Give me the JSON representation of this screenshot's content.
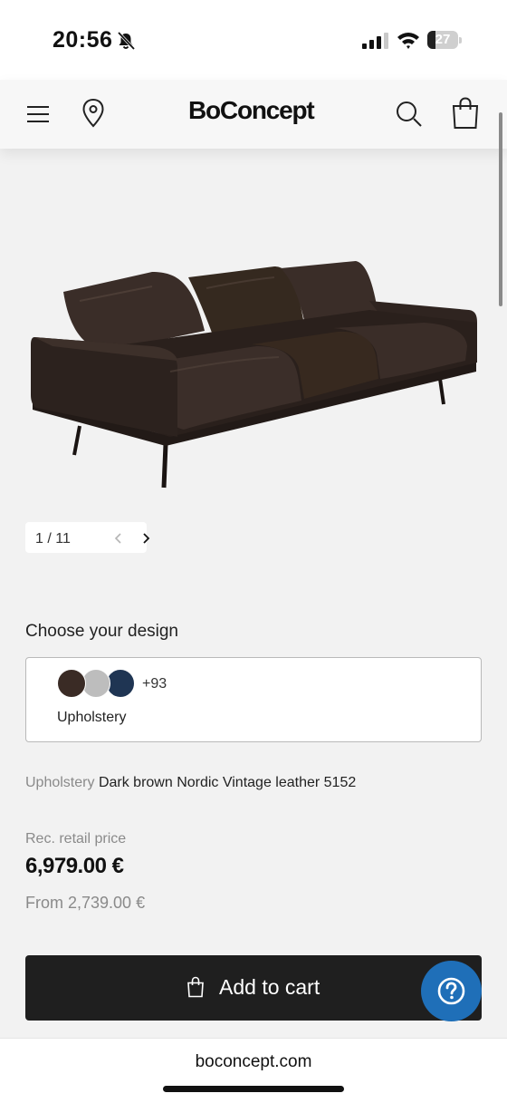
{
  "status_bar": {
    "time": "20:56",
    "battery": "27",
    "battery_level": 0.27
  },
  "header": {
    "logo": "BoConcept",
    "menu_icon": "hamburger-menu-icon",
    "location_icon": "location-pin-icon",
    "search_icon": "search-icon",
    "cart_icon": "shopping-bag-icon"
  },
  "gallery": {
    "pager": "1 / 11",
    "current_image": 1,
    "total_images": 11
  },
  "design": {
    "title": "Choose your design",
    "more_count": "+93",
    "upholstery_label": "Upholstery",
    "swatch_colors": [
      "#3a2b25",
      "#bdbdbd",
      "#1f3553"
    ]
  },
  "selection": {
    "label": "Upholstery",
    "value": "Dark brown Nordic Vintage leather 5152"
  },
  "price": {
    "label": "Rec. retail price",
    "amount": "6,979.00 €",
    "from": "From 2,739.00 €"
  },
  "actions": {
    "add_to_cart": "Add to cart",
    "help_icon": "question-mark-icon"
  },
  "browser": {
    "url": "boconcept.com"
  },
  "colors": {
    "background": "#f2f2f2",
    "button": "#1f1f1f",
    "help_button": "#1f6fb8",
    "sofa": "#2e2421"
  }
}
